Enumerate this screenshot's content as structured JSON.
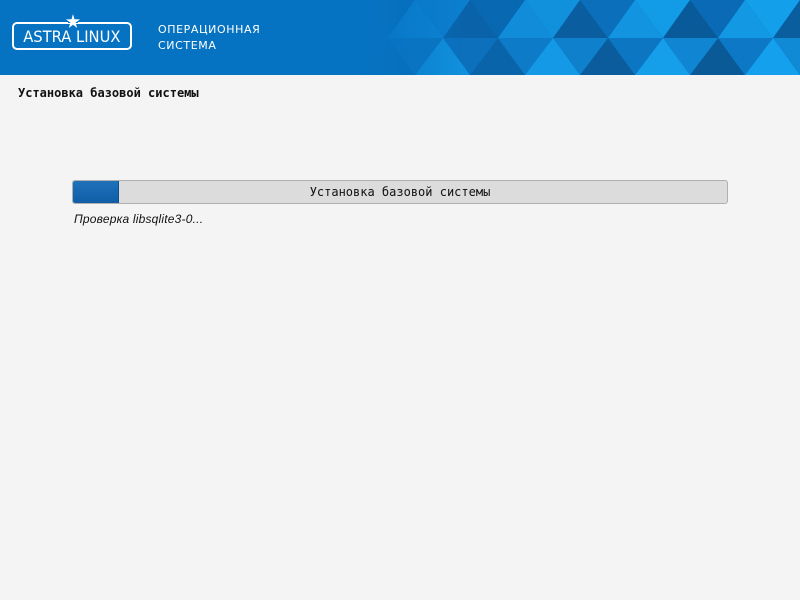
{
  "header": {
    "logo_text": "ASTRA LINUX",
    "tagline_line1": "ОПЕРАЦИОННАЯ",
    "tagline_line2": "СИСТЕМА",
    "brand_color": "#0573c2"
  },
  "page": {
    "title": "Установка базовой системы"
  },
  "progress": {
    "label": "Установка базовой системы",
    "percent": 7,
    "fill_color": "#1565b0"
  },
  "status": {
    "text": "Проверка  libsqlite3-0..."
  }
}
